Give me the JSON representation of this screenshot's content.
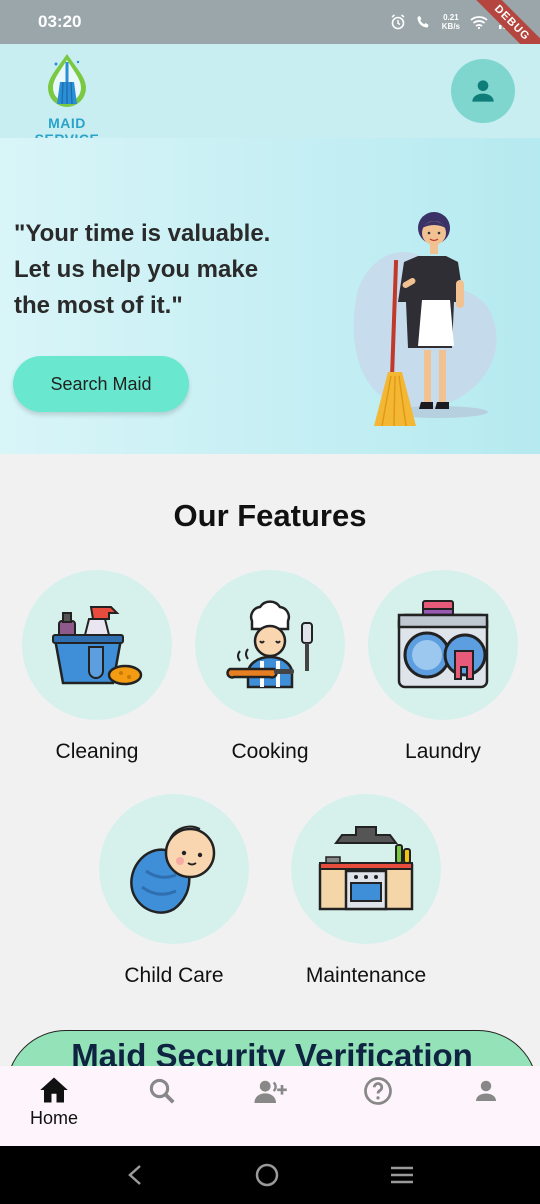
{
  "status_bar": {
    "time": "03:20",
    "net_speed_value": "0.21",
    "net_speed_unit": "KB/s",
    "debug_label": "DEBUG"
  },
  "header": {
    "logo_text": "MAID SERVICE",
    "profile_icon": "person-icon"
  },
  "hero": {
    "quote_line1": "\"Your time is valuable.",
    "quote_line2": "Let us help you make",
    "quote_line3": "the most of it.\"",
    "search_button_label": "Search Maid"
  },
  "features": {
    "title": "Our Features",
    "items": [
      {
        "label": "Cleaning",
        "icon": "cleaning-supplies-icon"
      },
      {
        "label": "Cooking",
        "icon": "chef-icon"
      },
      {
        "label": "Laundry",
        "icon": "washing-machine-icon"
      },
      {
        "label": "Child Care",
        "icon": "baby-icon"
      },
      {
        "label": "Maintenance",
        "icon": "kitchen-stove-icon"
      }
    ]
  },
  "verification": {
    "title": "Maid Security Verification"
  },
  "bottom_nav": {
    "items": [
      {
        "label": "Home",
        "icon": "home-icon",
        "active": true
      },
      {
        "label": "",
        "icon": "search-icon"
      },
      {
        "label": "",
        "icon": "add-user-icon"
      },
      {
        "label": "",
        "icon": "help-icon"
      },
      {
        "label": "",
        "icon": "person-icon"
      }
    ]
  },
  "colors": {
    "accent": "#69e8cf",
    "header_bg": "#c8eef2",
    "feature_circle": "#d6f1ec",
    "verify_banner": "#93e2b8"
  }
}
